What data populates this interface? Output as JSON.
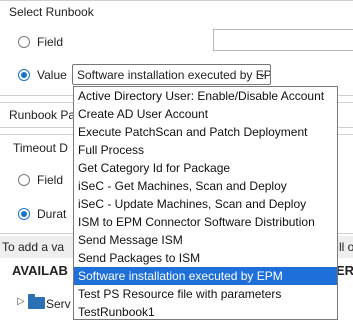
{
  "select_runbook": {
    "title": "Select Runbook",
    "field_label": "Field",
    "value_label": "Value",
    "selected_value": "Software installation executed by EPM"
  },
  "runbook_params": {
    "title": "Runbook Pa"
  },
  "timeout": {
    "title": "Timeout D",
    "field_label": "Field",
    "duration_label": "Durat"
  },
  "info_text": "To add a va",
  "info_text_right": "ll o",
  "available_heading": "AVAILAB",
  "available_heading_right": "ER",
  "tree_item": "Serv",
  "dropdown": {
    "options": [
      "Active Directory User: Enable/Disable Account",
      "Create AD User Account",
      "Execute PatchScan and Patch Deployment",
      "Full Process",
      "Get Category Id for Package",
      "iSeC - Get Machines, Scan and Deploy",
      "iSeC - Update Machines, Scan and Deploy",
      "ISM to EPM Connector Software Distribution",
      "Send Message ISM",
      "Send Packages to ISM",
      "Software installation executed by EPM",
      "Test PS Resource file with parameters",
      "TestRunbook1"
    ],
    "selected_index": 10
  }
}
